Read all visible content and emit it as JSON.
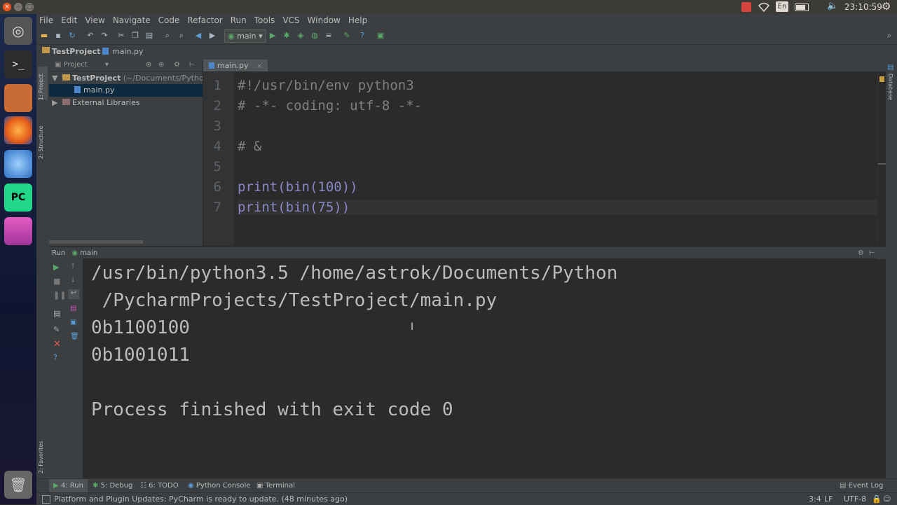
{
  "system_bar": {
    "window_buttons": [
      "×",
      "–",
      "□"
    ],
    "indicators": {
      "lang": "En",
      "clock": "23:10:59"
    },
    "icons": [
      "record-icon",
      "wifi-icon",
      "keyboard-icon",
      "battery-icon",
      "volume-icon",
      "clock-text",
      "power-gear-icon"
    ]
  },
  "menu": [
    "File",
    "Edit",
    "View",
    "Navigate",
    "Code",
    "Refactor",
    "Run",
    "Tools",
    "VCS",
    "Window",
    "Help"
  ],
  "toolbar": {
    "run_config": "main"
  },
  "breadcrumb": {
    "project": "TestProject",
    "file": "main.py"
  },
  "left_tabs": {
    "project": "1: Project",
    "structure": "2: Structure",
    "favorites": "2: Favorites"
  },
  "right_tabs": {
    "database": "Database"
  },
  "project_panel": {
    "header": "Project",
    "tree": [
      {
        "label": "TestProject",
        "suffix": " (~/Documents/Python/Py",
        "indent": 0,
        "kind": "folder",
        "open": true
      },
      {
        "label": "main.py",
        "suffix": "",
        "indent": 2,
        "kind": "file",
        "selected": true
      },
      {
        "label": "External Libraries",
        "suffix": "",
        "indent": 0,
        "kind": "lib",
        "open": false
      }
    ]
  },
  "editor": {
    "tab_label": "main.py",
    "lines": [
      {
        "n": "1",
        "text": "#!/usr/bin/env python3"
      },
      {
        "n": "2",
        "text": "# -*- coding: utf-8 -*-"
      },
      {
        "n": "3",
        "text": ""
      },
      {
        "n": "4",
        "text": "# &"
      },
      {
        "n": "5",
        "text": ""
      },
      {
        "n": "6",
        "text": "print(bin(100))"
      },
      {
        "n": "7",
        "text": "print(bin(75))"
      }
    ]
  },
  "run_panel": {
    "title": "Run",
    "config": "main",
    "output": [
      "/usr/bin/python3.5 /home/astrok/Documents/Python",
      " /PycharmProjects/TestProject/main.py",
      "0b1100100",
      "0b1001011",
      "",
      "Process finished with exit code 0"
    ]
  },
  "bottom_tabs": [
    {
      "label": "4: Run",
      "icon": "run-icon"
    },
    {
      "label": "5: Debug",
      "icon": "debug-icon"
    },
    {
      "label": "6: TODO",
      "icon": "todo-icon"
    },
    {
      "label": "Python Console",
      "icon": "python-console-icon"
    },
    {
      "label": "Terminal",
      "icon": "terminal-icon"
    }
  ],
  "event_log": "Event Log",
  "status": {
    "message": "Platform and Plugin Updates: PyCharm is ready to update. (48 minutes ago)",
    "position": "3:4",
    "line_sep": "LF",
    "encoding": "UTF-8"
  },
  "colors": {
    "accent_green": "#59a869",
    "keyword": "#cc7832",
    "comment": "#808080",
    "number": "#6897bb",
    "builtin": "#8888c6"
  }
}
